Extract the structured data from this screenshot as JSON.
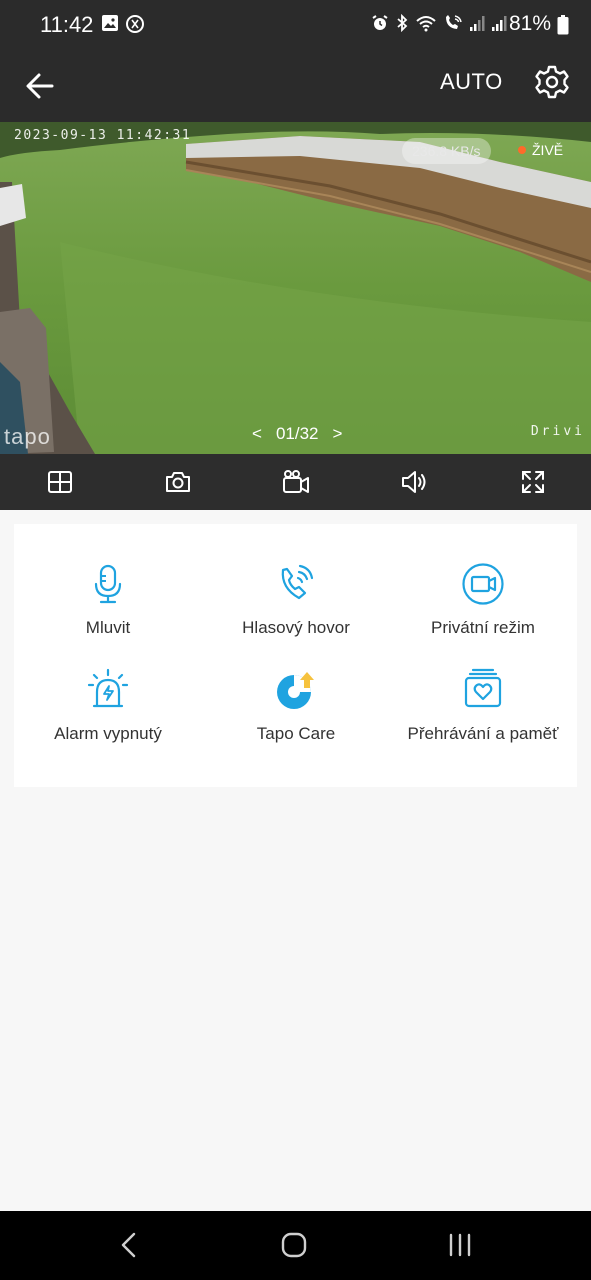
{
  "status_bar": {
    "time": "11:42",
    "battery": "81%",
    "icons": [
      "gallery-icon",
      "sync-icon",
      "alarm-icon",
      "bluetooth-icon",
      "wifi-icon",
      "wifi-call-icon",
      "signal-icon",
      "signal-icon",
      "battery-icon"
    ]
  },
  "app_bar": {
    "mode": "AUTO"
  },
  "camera": {
    "timestamp": "2023-09-13  11:42:31",
    "bitrate": "236.8 KB/s",
    "live_label": "ŽIVĚ",
    "watermark": "tapo",
    "drive_text": "Drivi",
    "page_prev": "<",
    "page": "01/32",
    "page_next": ">"
  },
  "toolbar": {
    "icons": [
      "grid-icon",
      "snapshot-icon",
      "record-icon",
      "volume-icon",
      "fullscreen-icon"
    ]
  },
  "features": [
    {
      "label": "Mluvit",
      "icon": "microphone-icon"
    },
    {
      "label": "Hlasový hovor",
      "icon": "phone-call-icon"
    },
    {
      "label": "Privátní režim",
      "icon": "camera-icon"
    },
    {
      "label": "Alarm vypnutý",
      "icon": "alarm-siren-icon"
    },
    {
      "label": "Tapo Care",
      "icon": "tapo-care-icon"
    },
    {
      "label": "Přehrávání a paměť",
      "icon": "playback-memory-icon"
    }
  ],
  "colors": {
    "accent": "#1fa3e0",
    "bar": "#2b2b2b",
    "live_dot": "#ff6a2a",
    "care_yellow": "#f6c23e"
  }
}
